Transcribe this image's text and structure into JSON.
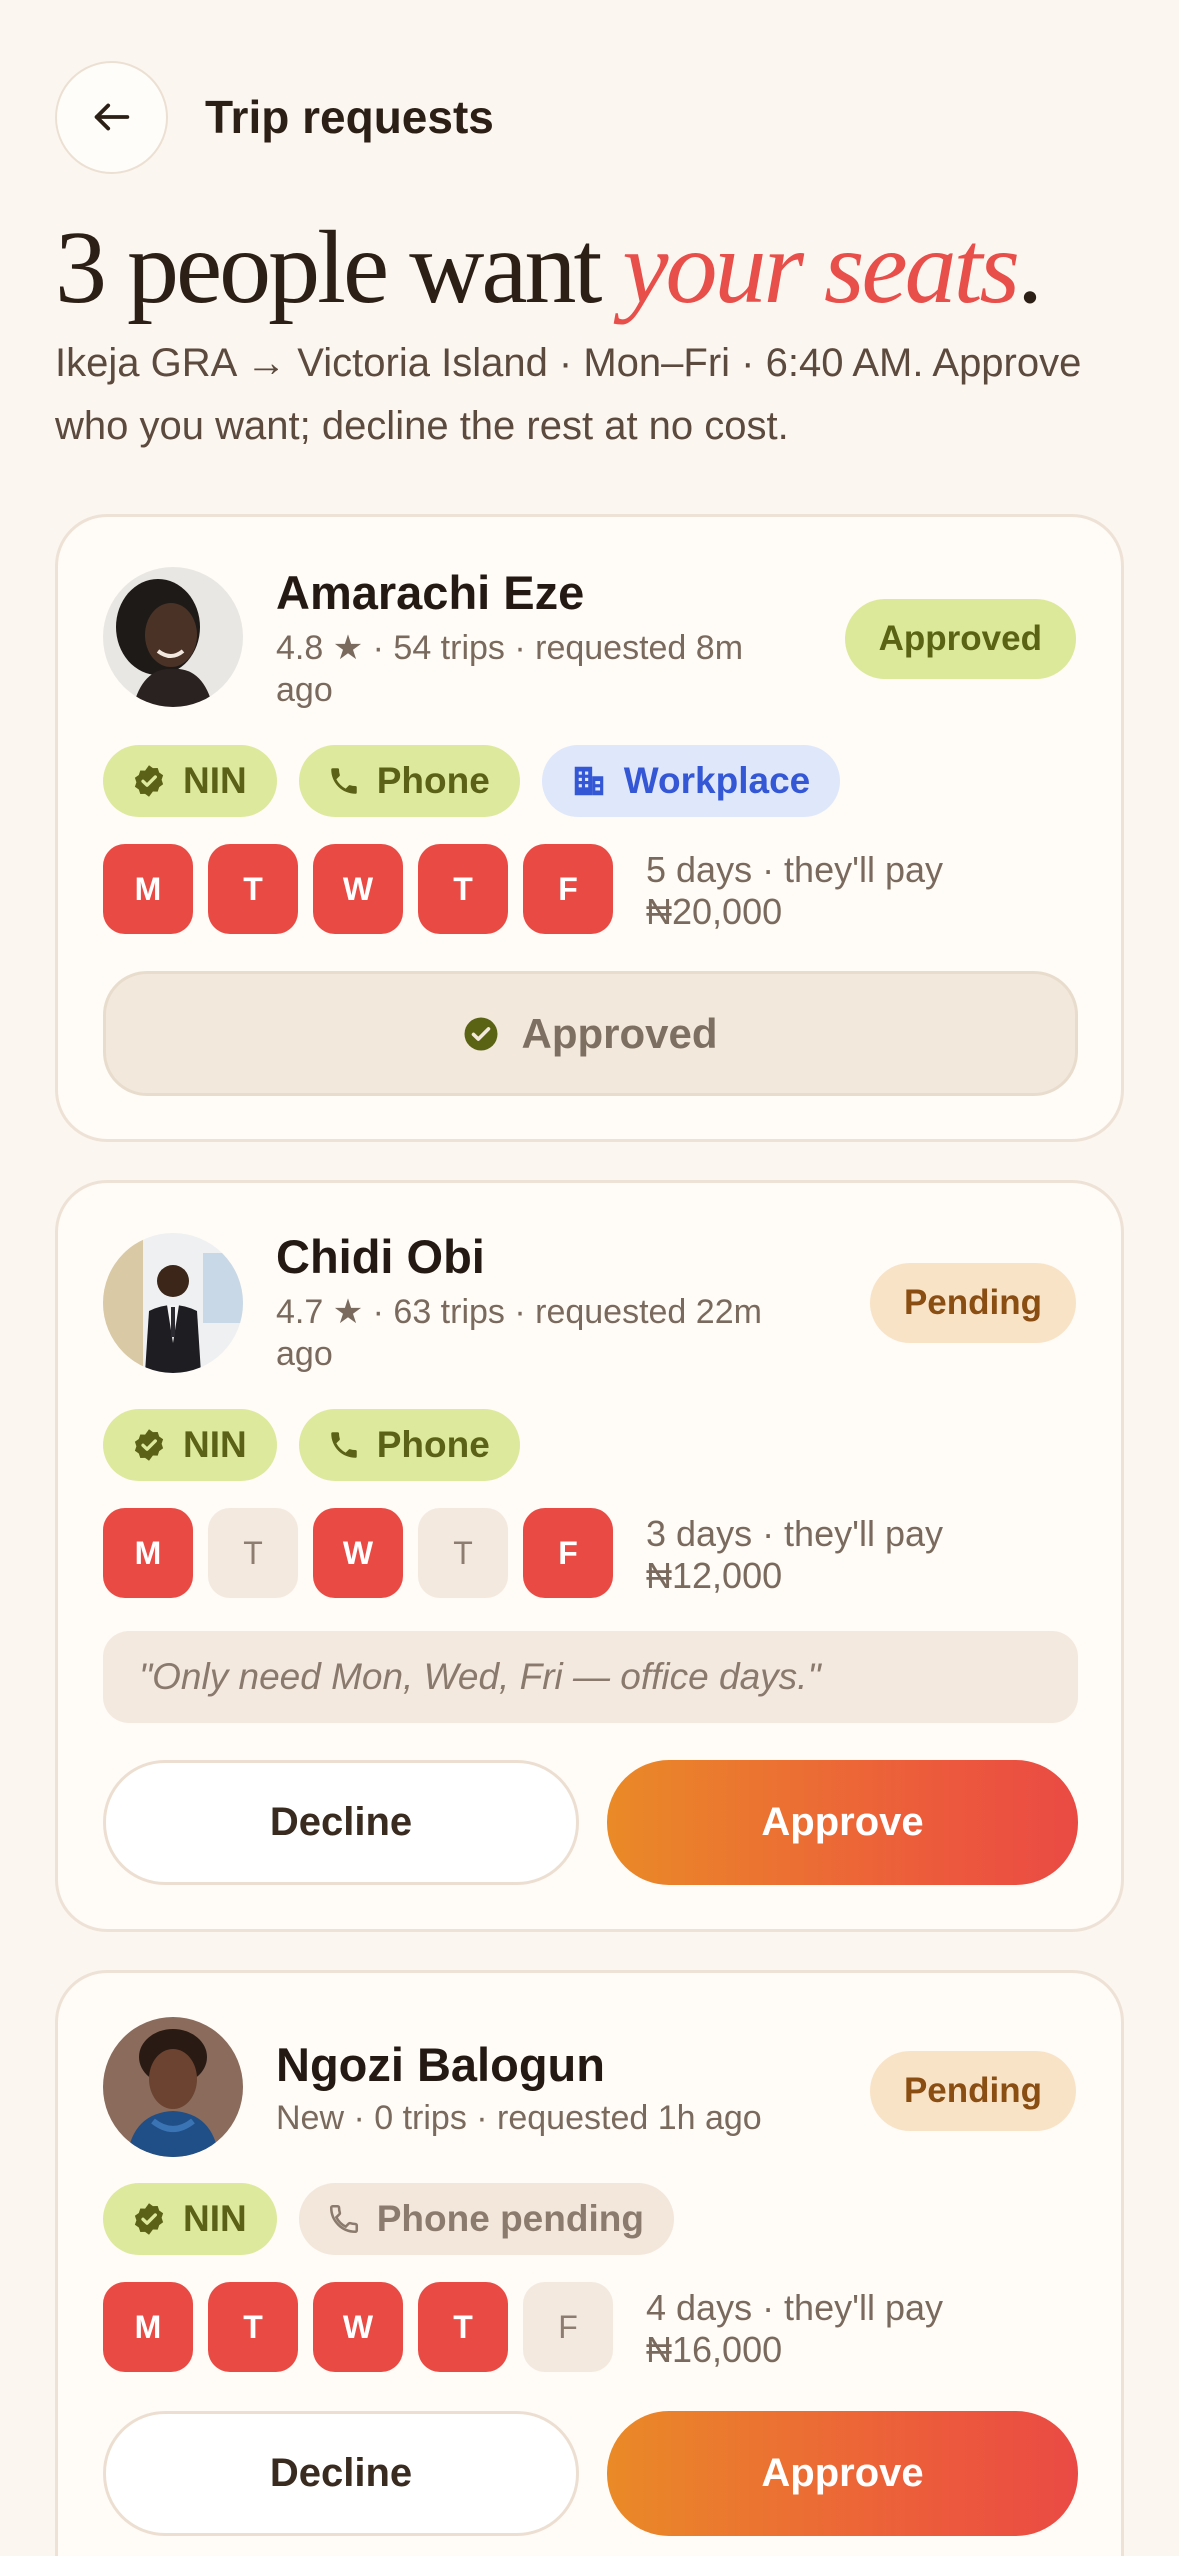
{
  "header": {
    "title": "Trip requests"
  },
  "hero": {
    "headline_prefix": "3 people want ",
    "headline_accent": "your seats",
    "headline_suffix": ".",
    "subline": "Ikeja GRA → Victoria Island · Mon–Fri · 6:40 AM. Approve who you want; decline the rest at no cost."
  },
  "requests": [
    {
      "name": "Amarachi Eze",
      "meta": "4.8 ★ · 54 trips · requested 8m ago",
      "status": "Approved",
      "chips": [
        "NIN",
        "Phone",
        "Workplace"
      ],
      "days": [
        "M",
        "T",
        "W",
        "T",
        "F"
      ],
      "days_on": [
        true,
        true,
        true,
        true,
        true
      ],
      "pay_line1": "5 days · they'll pay",
      "pay_line2": "₦20,000",
      "approved_label": "Approved"
    },
    {
      "name": "Chidi Obi",
      "meta": "4.7 ★ · 63 trips · requested 22m ago",
      "status": "Pending",
      "chips": [
        "NIN",
        "Phone"
      ],
      "days": [
        "M",
        "T",
        "W",
        "T",
        "F"
      ],
      "days_on": [
        true,
        false,
        true,
        false,
        true
      ],
      "pay_line1": "3 days · they'll pay",
      "pay_line2": "₦12,000",
      "note": "\"Only need Mon, Wed, Fri — office days.\"",
      "decline_label": "Decline",
      "approve_label": "Approve"
    },
    {
      "name": "Ngozi Balogun",
      "meta": "New · 0 trips · requested 1h ago",
      "status": "Pending",
      "chips": [
        "NIN",
        "Phone pending"
      ],
      "days": [
        "M",
        "T",
        "W",
        "T",
        "F"
      ],
      "days_on": [
        true,
        true,
        true,
        true,
        false
      ],
      "pay_line1": "4 days · they'll pay",
      "pay_line2": "₦16,000",
      "decline_label": "Decline",
      "approve_label": "Approve"
    }
  ],
  "colors": {
    "accent": "#e84e4a",
    "background": "#fcf6f0",
    "approved_badge": "#dce99a",
    "pending_badge": "#f8e3c7",
    "day_on": "#ea4a44",
    "approve_gradient_start": "#ea8a27",
    "approve_gradient_end": "#ea4a44"
  },
  "icons": {
    "back": "arrow-left-icon",
    "verified": "verified-badge-icon",
    "phone": "phone-icon",
    "workplace": "building-icon",
    "approved": "check-circle-icon"
  }
}
